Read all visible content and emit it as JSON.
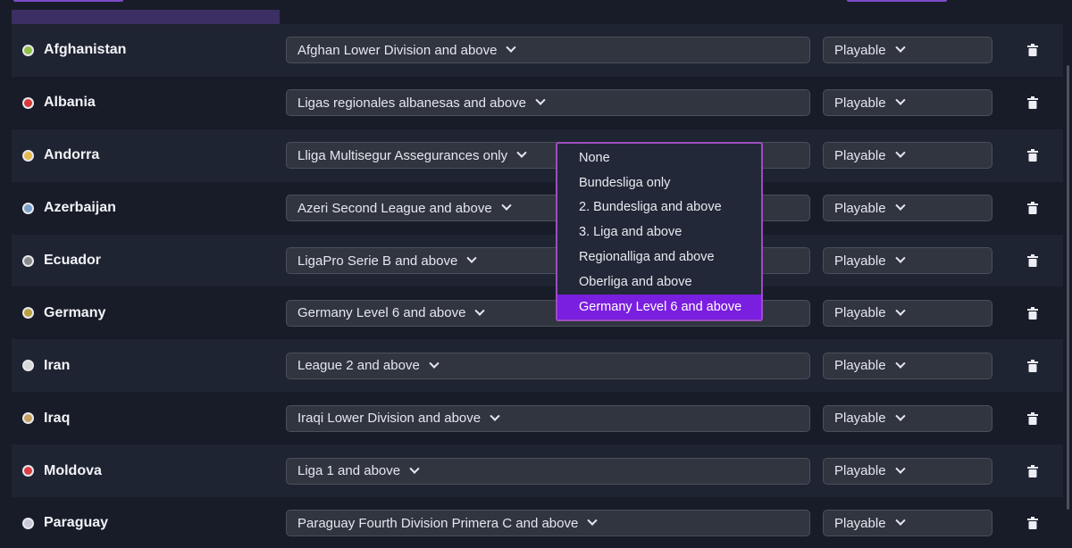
{
  "rows": [
    {
      "country": "Afghanistan",
      "league": "Afghan Lower Division and above",
      "status": "Playable",
      "flag_color": "#8fbf4a"
    },
    {
      "country": "Albania",
      "league": "Ligas regionales albanesas and above",
      "status": "Playable",
      "flag_color": "#d83a3a"
    },
    {
      "country": "Andorra",
      "league": "Lliga Multisegur Assegurances only",
      "status": "Playable",
      "flag_color": "#e8b84a"
    },
    {
      "country": "Azerbaijan",
      "league": "Azeri Second League and above",
      "status": "Playable",
      "flag_color": "#7aa0c8"
    },
    {
      "country": "Ecuador",
      "league": "LigaPro Serie B and above",
      "status": "Playable",
      "flag_color": "#8a8a8a"
    },
    {
      "country": "Germany",
      "league": "Germany Level 6 and above",
      "status": "Playable",
      "flag_color": "#b8a040"
    },
    {
      "country": "Iran",
      "league": "League 2 and above",
      "status": "Playable",
      "flag_color": "#d8d8d8"
    },
    {
      "country": "Iraq",
      "league": "Iraqi Lower Division and above",
      "status": "Playable",
      "flag_color": "#c8a060"
    },
    {
      "country": "Moldova",
      "league": "Liga 1 and above",
      "status": "Playable",
      "flag_color": "#d84040"
    },
    {
      "country": "Paraguay",
      "league": "Paraguay Fourth Division Primera C and above",
      "status": "Playable",
      "flag_color": "#c8c8d8"
    }
  ],
  "dropdown": {
    "items": [
      "None",
      "Bundesliga only",
      "2. Bundesliga and above",
      "3. Liga and above",
      "Regionalliga and above",
      "Oberliga and above",
      "Germany Level 6 and above"
    ],
    "selected": "Germany Level 6 and above"
  },
  "icons": {
    "flag": "flag-icon",
    "chevron": "chevron-down-icon",
    "delete": "trash-icon"
  },
  "colors": {
    "background": "#181c28",
    "row_alt": "#1f2432",
    "accent": "#7a1ee0",
    "dropdown_border": "#9b4fbf"
  }
}
